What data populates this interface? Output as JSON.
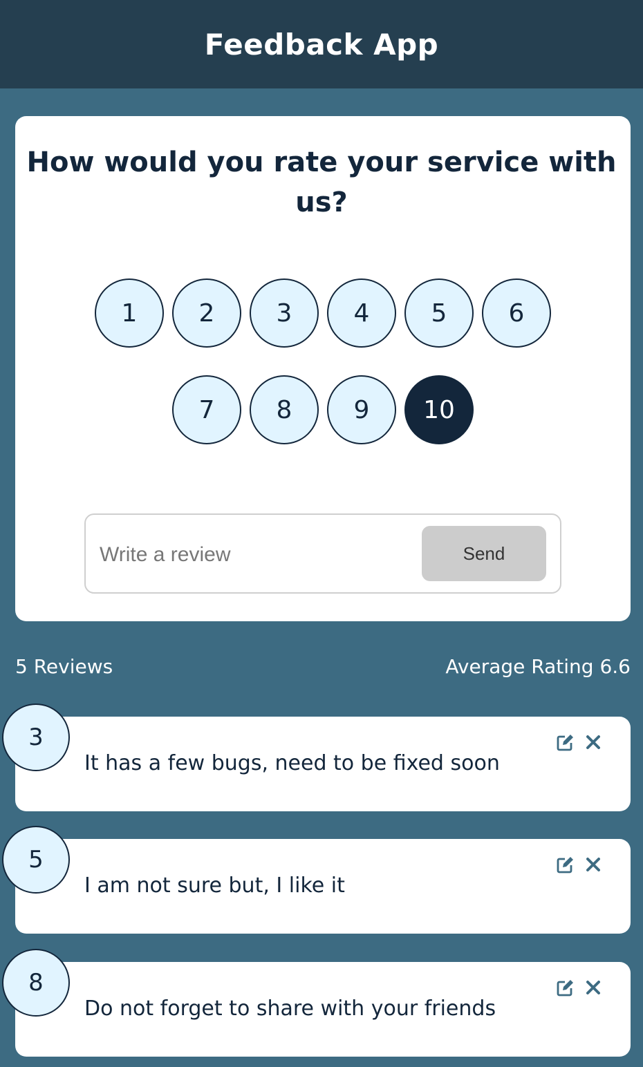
{
  "header": {
    "title": "Feedback App"
  },
  "form": {
    "question": "How would you rate your service with us?",
    "ratings": [
      "1",
      "2",
      "3",
      "4",
      "5",
      "6",
      "7",
      "8",
      "9",
      "10"
    ],
    "selected_rating": "10",
    "review_placeholder": "Write a review",
    "send_label": "Send"
  },
  "stats": {
    "count_label": "5 Reviews",
    "average_label": "Average Rating 6.6"
  },
  "reviews": [
    {
      "rating": "3",
      "text": "It has a few bugs, need to be fixed soon"
    },
    {
      "rating": "5",
      "text": "I am not sure but, I like it"
    },
    {
      "rating": "8",
      "text": "Do not forget to share with your friends"
    }
  ],
  "colors": {
    "header_bg": "#253f50",
    "page_bg": "#3d6b82",
    "primary": "#13263b",
    "badge_bg": "#e1f4ff",
    "icon": "#3d6b82"
  },
  "icons": {
    "edit": "edit-icon",
    "delete": "close-icon"
  }
}
